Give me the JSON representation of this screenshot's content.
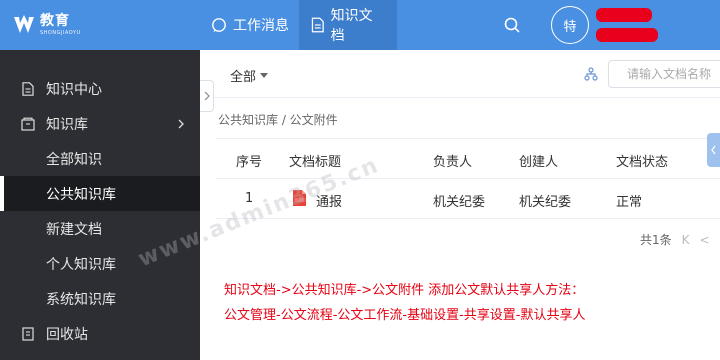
{
  "brand": {
    "main": "教育",
    "sub": "SHONGJIAOYU"
  },
  "nav": {
    "tabs": [
      {
        "label": "工作消息",
        "icon": "chat-icon",
        "active": false
      },
      {
        "label": "知识文档",
        "icon": "document-icon",
        "active": true
      }
    ]
  },
  "user": {
    "avatar_text": "特"
  },
  "sidebar": {
    "items": [
      {
        "label": "知识中心",
        "icon": "document-icon"
      },
      {
        "label": "知识库",
        "icon": "folder-icon"
      },
      {
        "label": "全部知识"
      },
      {
        "label": "公共知识库",
        "active": true
      },
      {
        "label": "新建文档"
      },
      {
        "label": "个人知识库"
      },
      {
        "label": "系统知识库"
      },
      {
        "label": "回收站",
        "icon": "trash-icon"
      }
    ]
  },
  "filter": {
    "all_label": "全部",
    "search_placeholder": "请输入文档名称"
  },
  "breadcrumb": "公共知识库 / 公文附件",
  "table": {
    "headers": [
      "序号",
      "文档标题",
      "负责人",
      "创建人",
      "文档状态"
    ],
    "rows": [
      {
        "index": "1",
        "title": "通报",
        "owner": "机关纪委",
        "creator": "机关纪委",
        "status": "正常"
      }
    ]
  },
  "pagination": {
    "total": "共1条",
    "first": "K",
    "prev": "<"
  },
  "annotation": {
    "line1": "知识文档->公共知识库->公文附件 添加公文默认共享人方法：",
    "line2": "公文管理-公文流程-公文工作流-基础设置-共享设置-默认共享人"
  },
  "watermark": "www.admin365.cn",
  "colors": {
    "topbar": "#4a90e2",
    "sidebar": "#2c2e33",
    "annotation": "#e60012"
  }
}
